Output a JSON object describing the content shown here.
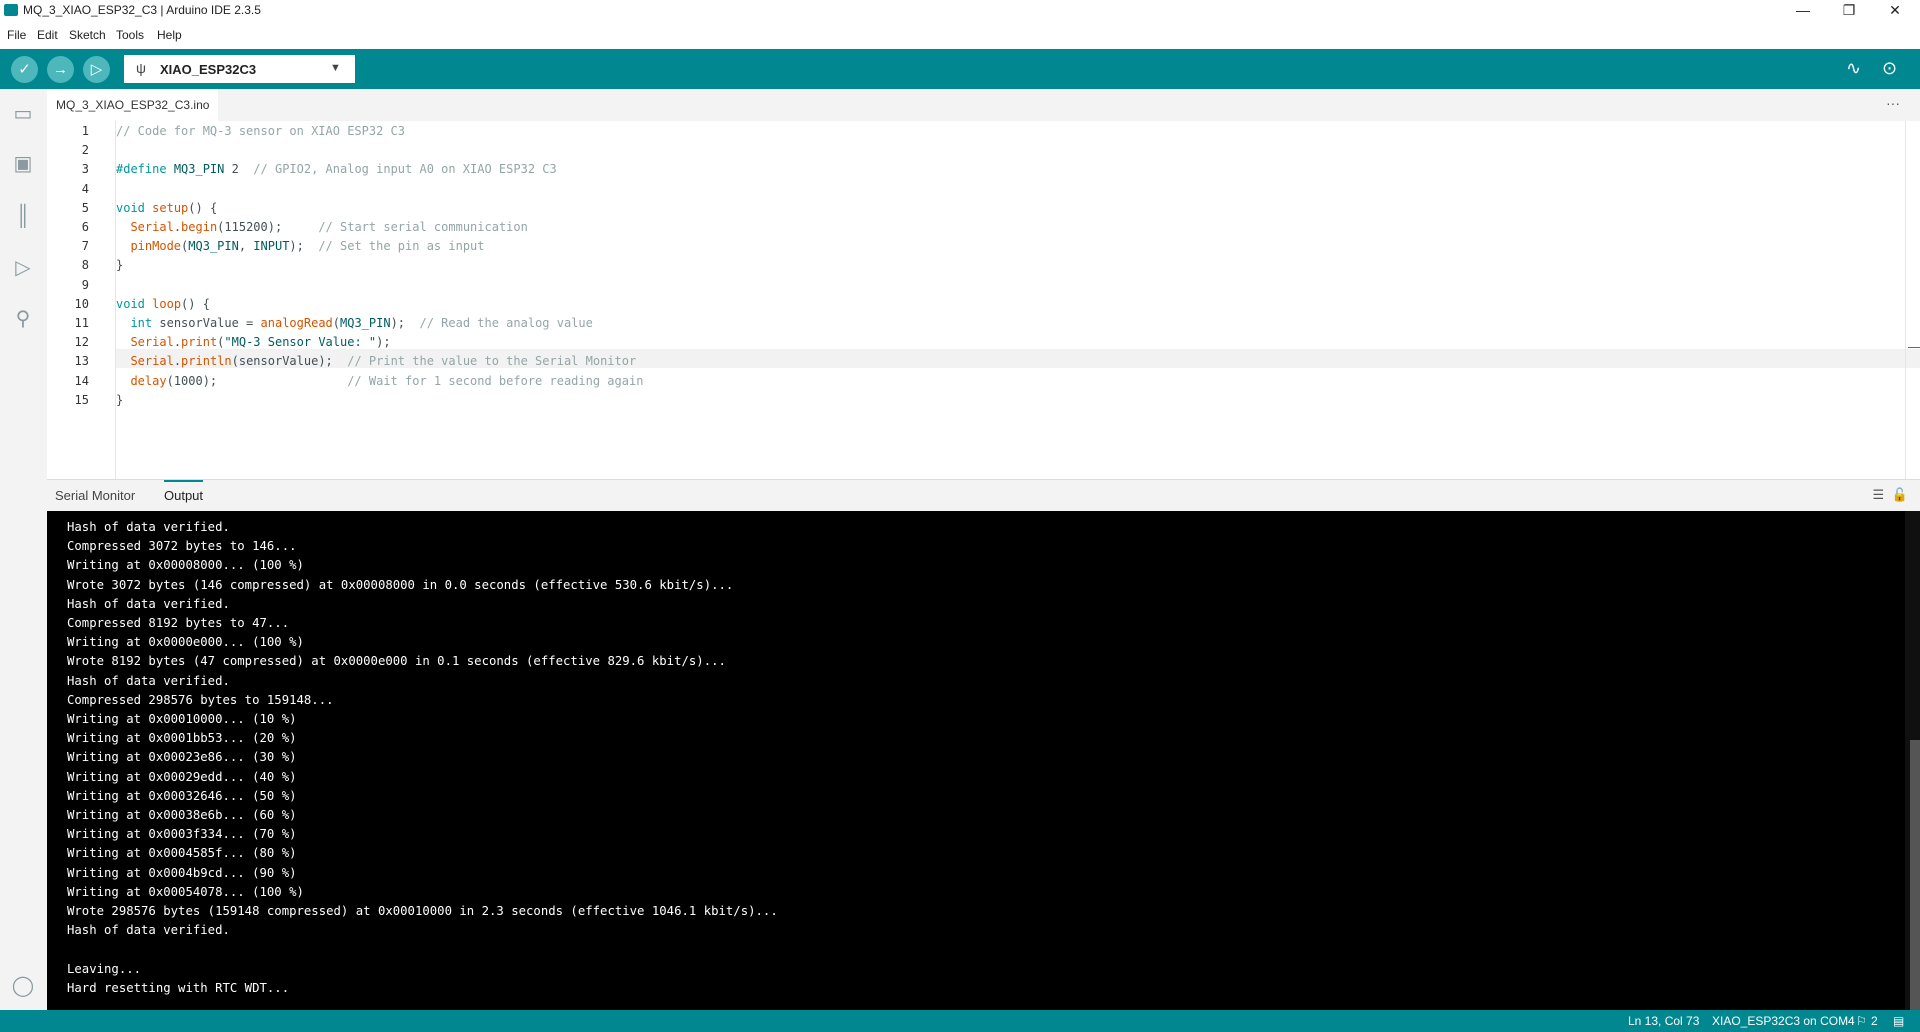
{
  "window": {
    "title": "MQ_3_XIAO_ESP32_C3 | Arduino IDE 2.3.5",
    "minimize": "—",
    "maximize": "❐",
    "close": "✕"
  },
  "menu": [
    "File",
    "Edit",
    "Sketch",
    "Tools",
    "Help"
  ],
  "toolbar": {
    "board": "XIAO_ESP32C3",
    "icons": [
      "verify-icon",
      "upload-icon",
      "debug-icon",
      "serial-plotter-icon",
      "serial-monitor-icon"
    ]
  },
  "editor": {
    "tab_name": "MQ_3_XIAO_ESP32_C3.ino",
    "current_line": 13,
    "lines": [
      "// Code for MQ-3 sensor on XIAO ESP32 C3",
      "",
      "#define MQ3_PIN 2  // GPIO2, Analog input A0 on XIAO ESP32 C3",
      "",
      "void setup() {",
      "  Serial.begin(115200);     // Start serial communication",
      "  pinMode(MQ3_PIN, INPUT);  // Set the pin as input",
      "}",
      "",
      "void loop() {",
      "  int sensorValue = analogRead(MQ3_PIN);  // Read the analog value",
      "  Serial.print(\"MQ-3 Sensor Value: \");",
      "  Serial.println(sensorValue);  // Print the value to the Serial Monitor",
      "  delay(1000);                  // Wait for 1 second before reading again",
      "}"
    ]
  },
  "panel": {
    "tabs": [
      "Serial Monitor",
      "Output"
    ],
    "active_tab": "Output",
    "output_lines": [
      "Hash of data verified.",
      "Compressed 3072 bytes to 146...",
      "Writing at 0x00008000... (100 %)",
      "Wrote 3072 bytes (146 compressed) at 0x00008000 in 0.0 seconds (effective 530.6 kbit/s)...",
      "Hash of data verified.",
      "Compressed 8192 bytes to 47...",
      "Writing at 0x0000e000... (100 %)",
      "Wrote 8192 bytes (47 compressed) at 0x0000e000 in 0.1 seconds (effective 829.6 kbit/s)...",
      "Hash of data verified.",
      "Compressed 298576 bytes to 159148...",
      "Writing at 0x00010000... (10 %)",
      "Writing at 0x0001bb53... (20 %)",
      "Writing at 0x00023e86... (30 %)",
      "Writing at 0x00029edd... (40 %)",
      "Writing at 0x00032646... (50 %)",
      "Writing at 0x00038e6b... (60 %)",
      "Writing at 0x0003f334... (70 %)",
      "Writing at 0x0004585f... (80 %)",
      "Writing at 0x0004b9cd... (90 %)",
      "Writing at 0x00054078... (100 %)",
      "Wrote 298576 bytes (159148 compressed) at 0x00010000 in 2.3 seconds (effective 1046.1 kbit/s)...",
      "Hash of data verified.",
      "",
      "Leaving...",
      "Hard resetting with RTC WDT..."
    ]
  },
  "status": {
    "cursor": "Ln 13, Col 73",
    "board_port": "XIAO_ESP32C3 on COM4",
    "notifications": "2"
  },
  "colors": {
    "accent": "#00878f",
    "keyword": "#00979d",
    "function": "#d35400",
    "comment": "#95a5a6"
  }
}
